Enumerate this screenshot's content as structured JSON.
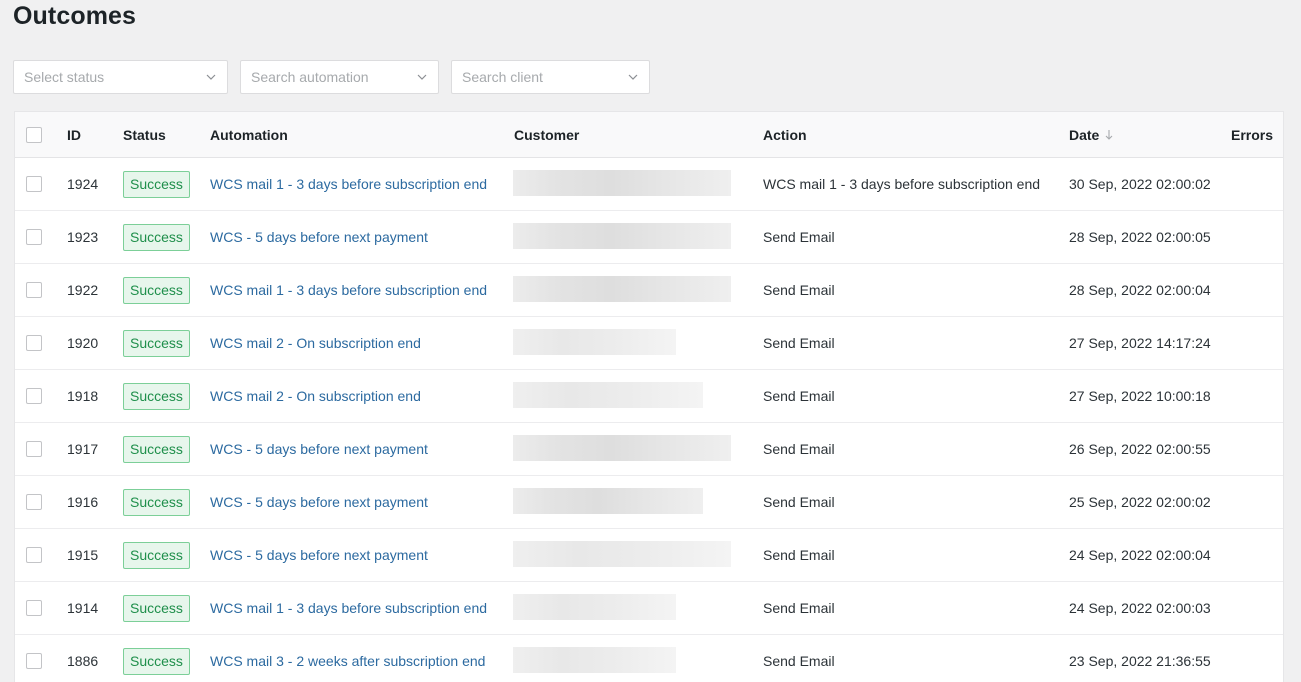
{
  "page": {
    "title": "Outcomes"
  },
  "filters": {
    "status_placeholder": "Select status",
    "automation_placeholder": "Search automation",
    "client_placeholder": "Search client"
  },
  "table": {
    "headers": {
      "id": "ID",
      "status": "Status",
      "automation": "Automation",
      "customer": "Customer",
      "action": "Action",
      "date": "Date",
      "errors": "Errors"
    },
    "rows": [
      {
        "id": "1924",
        "status": "Success",
        "automation": "WCS mail 1 - 3 days before subscription end",
        "action": "WCS mail 1 - 3 days before subscription end",
        "date": "30 Sep, 2022 02:00:02",
        "errors": ""
      },
      {
        "id": "1923",
        "status": "Success",
        "automation": "WCS - 5 days before next payment",
        "action": "Send Email",
        "date": "28 Sep, 2022 02:00:05",
        "errors": ""
      },
      {
        "id": "1922",
        "status": "Success",
        "automation": "WCS mail 1 - 3 days before subscription end",
        "action": "Send Email",
        "date": "28 Sep, 2022 02:00:04",
        "errors": ""
      },
      {
        "id": "1920",
        "status": "Success",
        "automation": "WCS mail 2 - On subscription end",
        "action": "Send Email",
        "date": "27 Sep, 2022 14:17:24",
        "errors": ""
      },
      {
        "id": "1918",
        "status": "Success",
        "automation": "WCS mail 2 - On subscription end",
        "action": "Send Email",
        "date": "27 Sep, 2022 10:00:18",
        "errors": ""
      },
      {
        "id": "1917",
        "status": "Success",
        "automation": "WCS - 5 days before next payment",
        "action": "Send Email",
        "date": "26 Sep, 2022 02:00:55",
        "errors": ""
      },
      {
        "id": "1916",
        "status": "Success",
        "automation": "WCS - 5 days before next payment",
        "action": "Send Email",
        "date": "25 Sep, 2022 02:00:02",
        "errors": ""
      },
      {
        "id": "1915",
        "status": "Success",
        "automation": "WCS - 5 days before next payment",
        "action": "Send Email",
        "date": "24 Sep, 2022 02:00:04",
        "errors": ""
      },
      {
        "id": "1914",
        "status": "Success",
        "automation": "WCS mail 1 - 3 days before subscription end",
        "action": "Send Email",
        "date": "24 Sep, 2022 02:00:03",
        "errors": ""
      },
      {
        "id": "1886",
        "status": "Success",
        "automation": "WCS mail 3 - 2 weeks after subscription end",
        "action": "Send Email",
        "date": "23 Sep, 2022 21:36:55",
        "errors": ""
      }
    ]
  },
  "colors": {
    "success_bg": "#e7f6ec",
    "success_border": "#7ccf98",
    "success_text": "#1f8f4b",
    "link": "#2c6aa0"
  },
  "icons": {
    "dropdown": "chevron-down-icon",
    "sort": "sort-down-arrow-icon"
  }
}
